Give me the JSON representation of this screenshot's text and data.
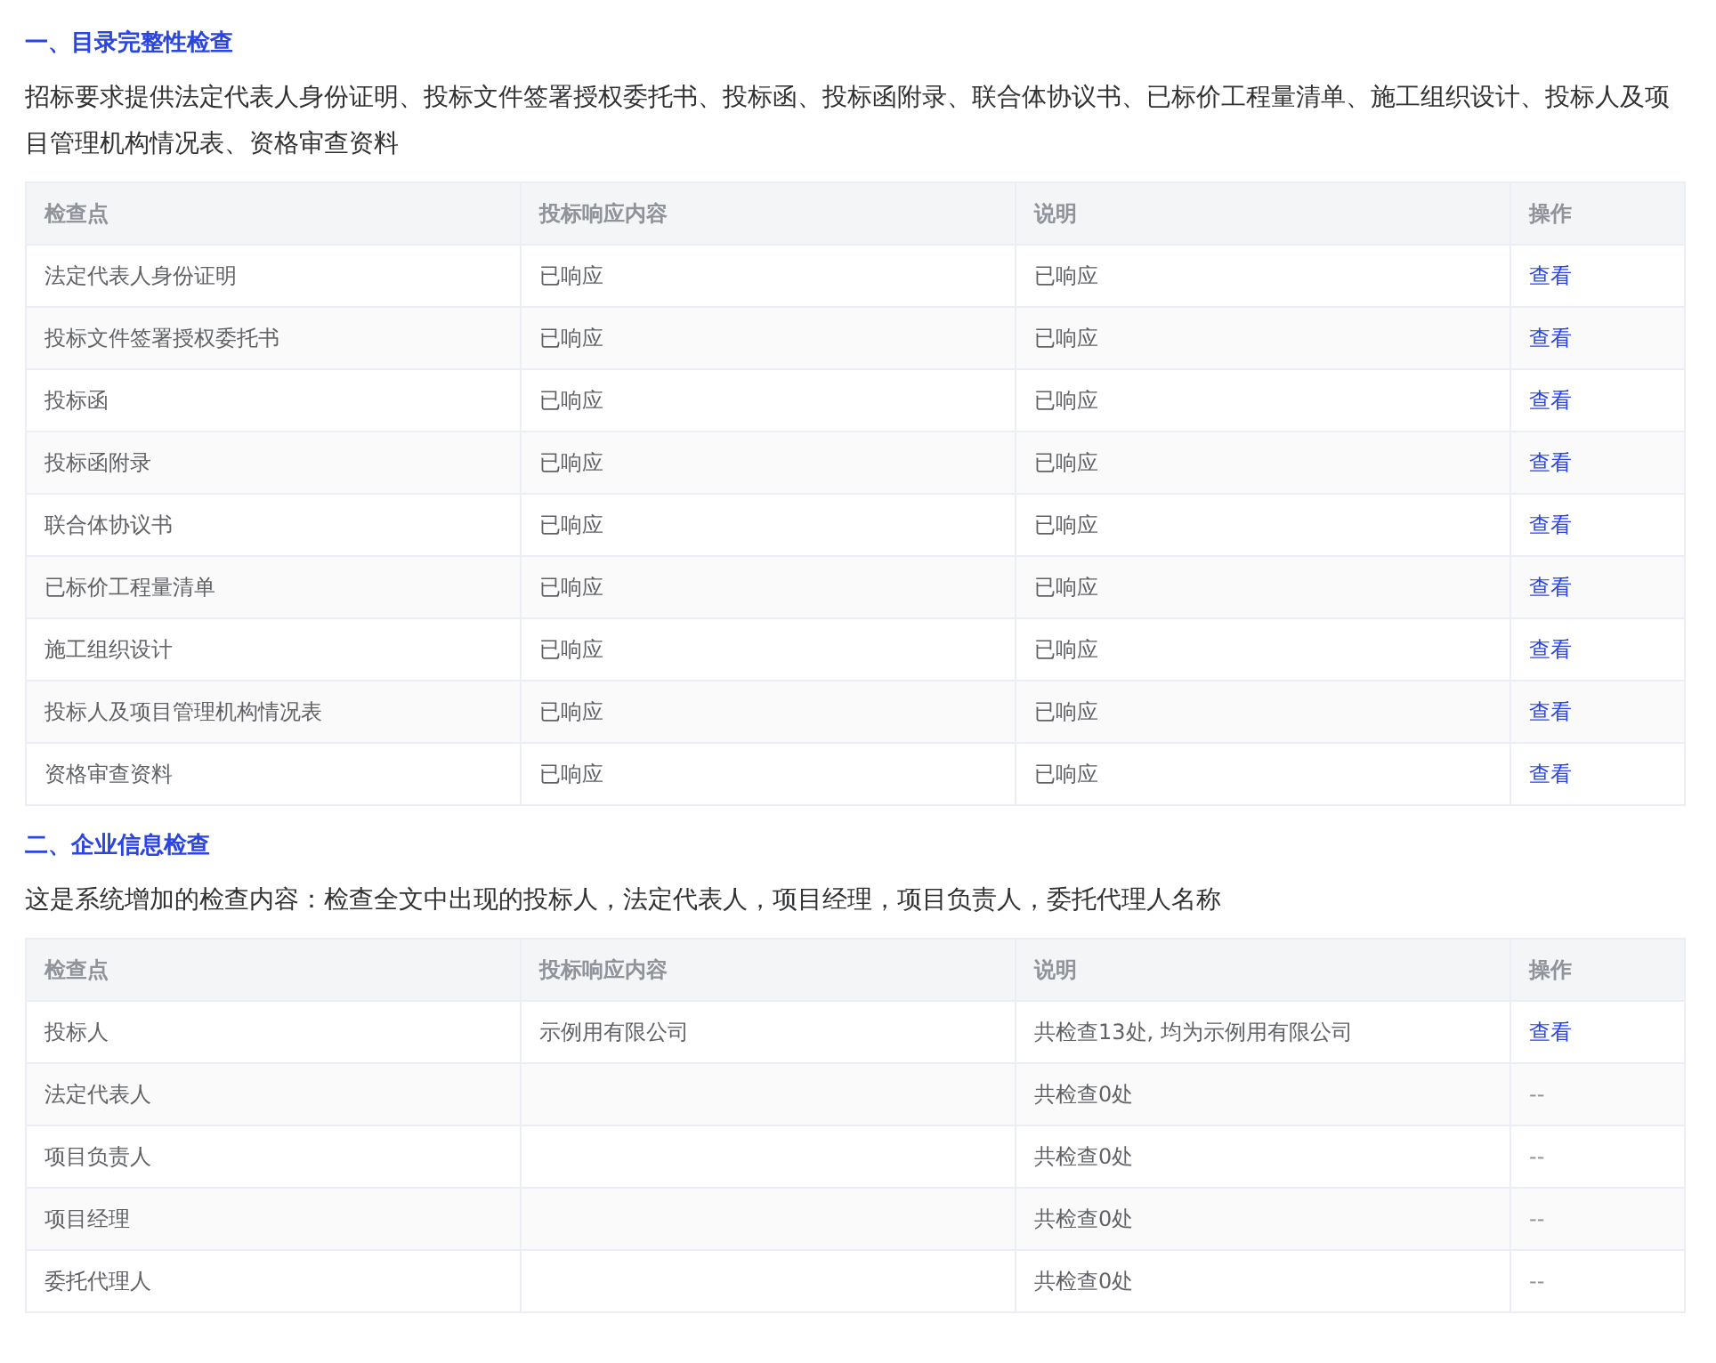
{
  "sections": [
    {
      "title": "一、目录完整性检查",
      "description": "招标要求提供法定代表人身份证明、投标文件签署授权委托书、投标函、投标函附录、联合体协议书、已标价工程量清单、施工组织设计、投标人及项目管理机构情况表、资格审查资料",
      "table": {
        "columns": [
          "检查点",
          "投标响应内容",
          "说明",
          "操作"
        ],
        "rows": [
          {
            "cells": [
              "法定代表人身份证明",
              "已响应",
              "已响应"
            ],
            "action": {
              "kind": "link",
              "label": "查看"
            }
          },
          {
            "cells": [
              "投标文件签署授权委托书",
              "已响应",
              "已响应"
            ],
            "action": {
              "kind": "link",
              "label": "查看"
            }
          },
          {
            "cells": [
              "投标函",
              "已响应",
              "已响应"
            ],
            "action": {
              "kind": "link",
              "label": "查看"
            }
          },
          {
            "cells": [
              "投标函附录",
              "已响应",
              "已响应"
            ],
            "action": {
              "kind": "link",
              "label": "查看"
            }
          },
          {
            "cells": [
              "联合体协议书",
              "已响应",
              "已响应"
            ],
            "action": {
              "kind": "link",
              "label": "查看"
            }
          },
          {
            "cells": [
              "已标价工程量清单",
              "已响应",
              "已响应"
            ],
            "action": {
              "kind": "link",
              "label": "查看"
            }
          },
          {
            "cells": [
              "施工组织设计",
              "已响应",
              "已响应"
            ],
            "action": {
              "kind": "link",
              "label": "查看"
            }
          },
          {
            "cells": [
              "投标人及项目管理机构情况表",
              "已响应",
              "已响应"
            ],
            "action": {
              "kind": "link",
              "label": "查看"
            }
          },
          {
            "cells": [
              "资格审查资料",
              "已响应",
              "已响应"
            ],
            "action": {
              "kind": "link",
              "label": "查看"
            }
          }
        ]
      }
    },
    {
      "title": "二、企业信息检查",
      "description": "这是系统增加的检查内容：检查全文中出现的投标人，法定代表人，项目经理，项目负责人，委托代理人名称",
      "table": {
        "columns": [
          "检查点",
          "投标响应内容",
          "说明",
          "操作"
        ],
        "rows": [
          {
            "cells": [
              "投标人",
              "示例用有限公司",
              "共检查13处, 均为示例用有限公司"
            ],
            "action": {
              "kind": "link",
              "label": "查看"
            }
          },
          {
            "cells": [
              "法定代表人",
              "",
              "共检查0处"
            ],
            "action": {
              "kind": "text",
              "label": "--"
            }
          },
          {
            "cells": [
              "项目负责人",
              "",
              "共检查0处"
            ],
            "action": {
              "kind": "text",
              "label": "--"
            }
          },
          {
            "cells": [
              "项目经理",
              "",
              "共检查0处"
            ],
            "action": {
              "kind": "text",
              "label": "--"
            }
          },
          {
            "cells": [
              "委托代理人",
              "",
              "共检查0处"
            ],
            "action": {
              "kind": "text",
              "label": "--"
            }
          }
        ]
      }
    }
  ]
}
